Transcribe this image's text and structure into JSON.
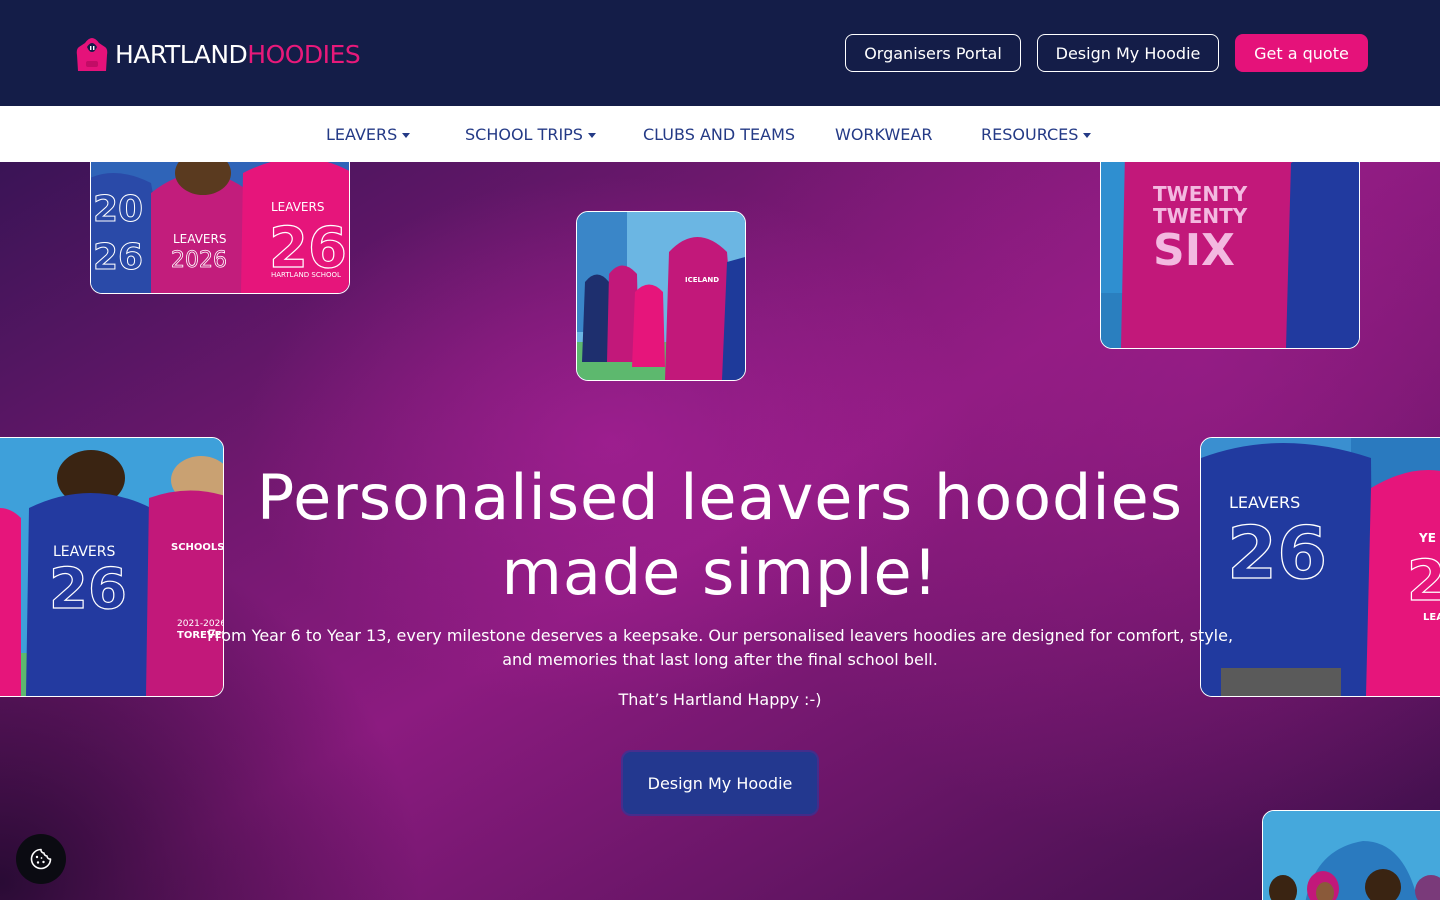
{
  "header": {
    "logo_part1": "HARTLAND",
    "logo_part2": "HOODIES",
    "buttons": {
      "portal": "Organisers Portal",
      "design": "Design My Hoodie",
      "quote": "Get a quote"
    }
  },
  "nav": {
    "items": [
      {
        "label": "LEAVERS",
        "dropdown": true
      },
      {
        "label": "SCHOOL TRIPS",
        "dropdown": true
      },
      {
        "label": "CLUBS AND TEAMS",
        "dropdown": false
      },
      {
        "label": "WORKWEAR",
        "dropdown": false
      },
      {
        "label": "RESOURCES",
        "dropdown": true
      }
    ]
  },
  "hero": {
    "title": "Personalised leavers hoodies made simple!",
    "lead": "From Year 6 to Year 13, every milestone deserves a keepsake. Our personalised leavers hoodies are designed for comfort, style, and memories that last long after the final school bell.",
    "tagline": "That’s Hartland Happy :-)",
    "cta": "Design My Hoodie"
  },
  "images": {
    "card1": {
      "texts": [
        "20",
        "26",
        "LEAVERS",
        "2026",
        "LEAVERS",
        "26",
        "HARTLAND SCHOOL"
      ]
    },
    "card2": {
      "texts": [
        "ICELAND"
      ]
    },
    "card3": {
      "texts": [
        "TWENTY",
        "TWENTY",
        "SIX"
      ]
    },
    "card4": {
      "texts": [
        "LEAVERS",
        "26",
        "SCHOOLS O",
        "2021-2026",
        "TOREVER"
      ]
    },
    "card5": {
      "texts": [
        "LEAVERS",
        "26",
        "YE",
        "2",
        "LEA"
      ]
    }
  },
  "colors": {
    "header_bg": "#141d48",
    "accent_pink": "#e5127a",
    "nav_text": "#243a86",
    "cta_bg": "#23388f"
  },
  "icons": {
    "logo": "hoodie-icon",
    "cookie": "cookie-icon"
  }
}
